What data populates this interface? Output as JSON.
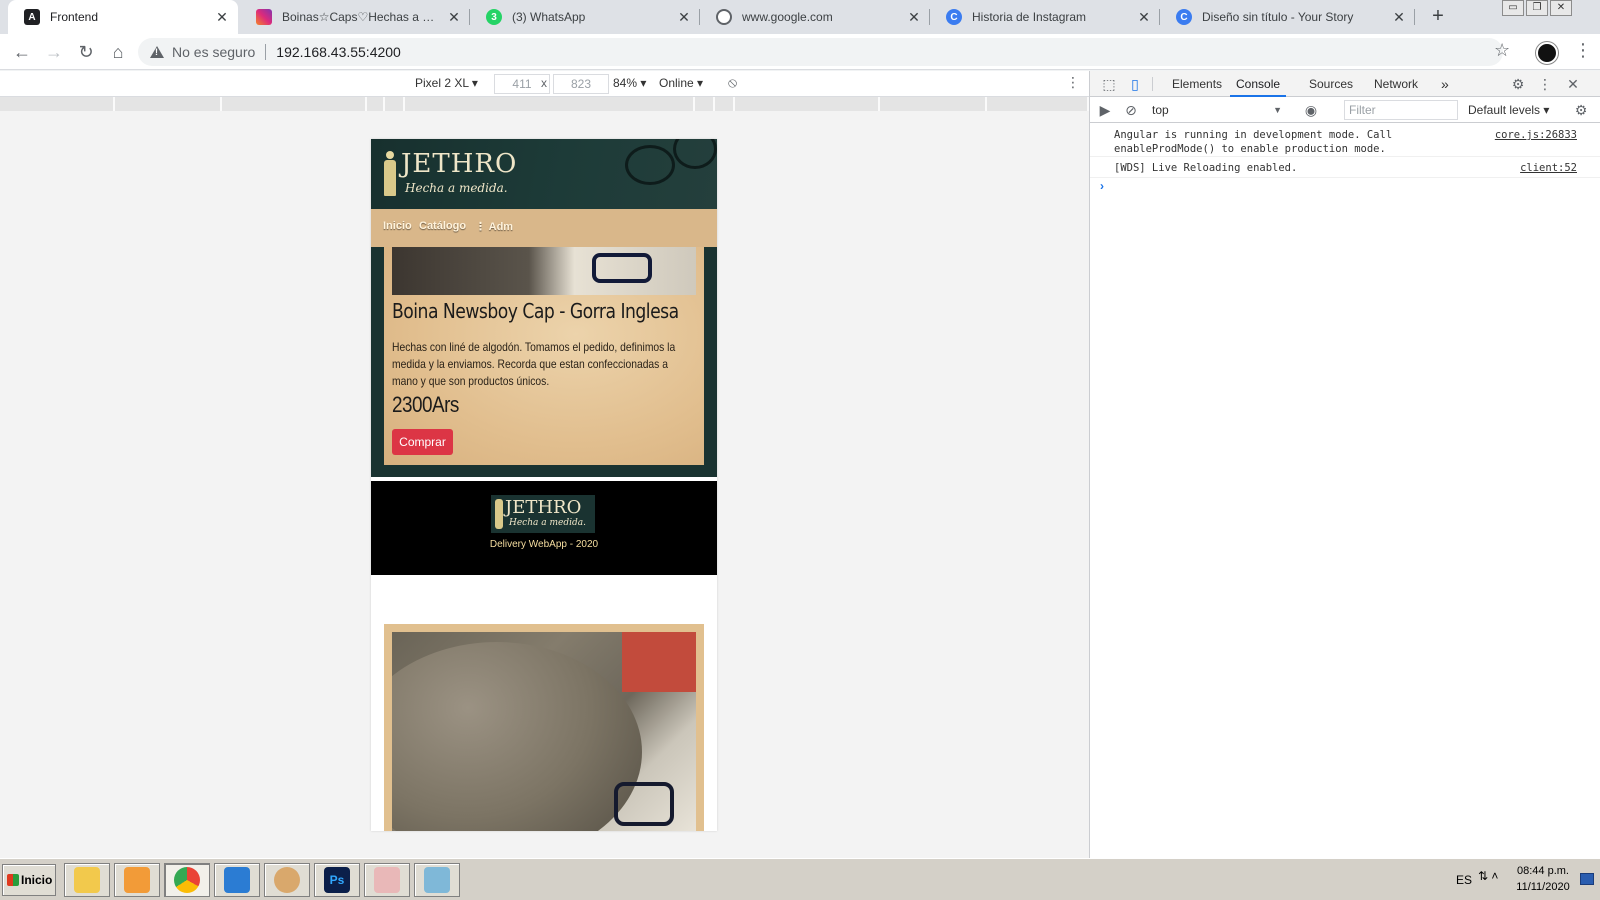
{
  "browser": {
    "tabs": [
      {
        "title": "Frontend",
        "icon": "angular-icon",
        "active": true
      },
      {
        "title": "Boinas☆Caps♡Hechas a medida on Instagram",
        "icon": "instagram-icon",
        "active": false
      },
      {
        "title": "(3) WhatsApp",
        "icon": "whatsapp-icon",
        "active": false
      },
      {
        "title": "www.google.com",
        "icon": "globe-icon",
        "active": false
      },
      {
        "title": "Historia de Instagram",
        "icon": "canva-icon",
        "active": false
      },
      {
        "title": "Diseño sin título - Your Story",
        "icon": "canva-icon",
        "active": false
      }
    ],
    "close_glyph": "✕",
    "new_tab_glyph": "+",
    "window_controls": [
      "▭",
      "❐",
      "✕"
    ],
    "nav": {
      "back": "←",
      "forward": "→",
      "reload": "↻",
      "home": "⌂"
    },
    "omnibox": {
      "security_label": "No es seguro",
      "url": "192.168.43.55:4200"
    },
    "star": "☆",
    "menu": "⋮"
  },
  "device_toolbar": {
    "device": "Pixel 2 XL",
    "width": "411",
    "times": "x",
    "height": "823",
    "zoom": "84%",
    "network": "Online",
    "rotate_icon": "rotate-icon",
    "menu": "⋮"
  },
  "page": {
    "brand": "JETHRO",
    "tagline": "Hecha a medida.",
    "nav": [
      "Inicio",
      "Catálogo",
      "⋮ Adm"
    ],
    "product": {
      "title": "Boina Newsboy Cap - Gorra Inglesa",
      "description": "Hechas con liné de algodón. Tomamos el pedido, definimos la medida y la enviamos. Recorda que estan confeccionadas a mano y que son productos únicos.",
      "price": "2300Ars",
      "buy_label": "Comprar"
    },
    "footer": {
      "brand": "JETHRO",
      "tagline": "Hecha a medida.",
      "text": "Delivery WebApp - 2020"
    }
  },
  "devtools": {
    "tabs": [
      "Elements",
      "Console",
      "Sources",
      "Network"
    ],
    "active_tab": "Console",
    "more": "»",
    "settings": "⚙",
    "menu": "⋮",
    "close": "✕",
    "context": "top",
    "filter_placeholder": "Filter",
    "levels": "Default levels ▾",
    "messages": [
      {
        "text": "Angular is running in development mode. Call enableProdMode() to enable production mode.",
        "source": "core.js:26833"
      },
      {
        "text": "[WDS] Live Reloading enabled.",
        "source": "client:52"
      }
    ],
    "prompt": "›"
  },
  "taskbar": {
    "start_label": "Inicio",
    "apps": [
      "file-manager-icon",
      "media-player-icon",
      "chrome-icon",
      "vscode-icon",
      "paint-icon",
      "photoshop-icon",
      "snipping-tool-icon",
      "notepad-icon"
    ],
    "lang": "ES",
    "time": "08:44 p.m.",
    "date": "11/11/2020"
  },
  "colors": {
    "accent": "#1a73e8",
    "header_green": "#1d3b38",
    "nav_tan": "#d9b78a",
    "buy_red": "#dc3545",
    "footer_text": "#f6dea0"
  }
}
